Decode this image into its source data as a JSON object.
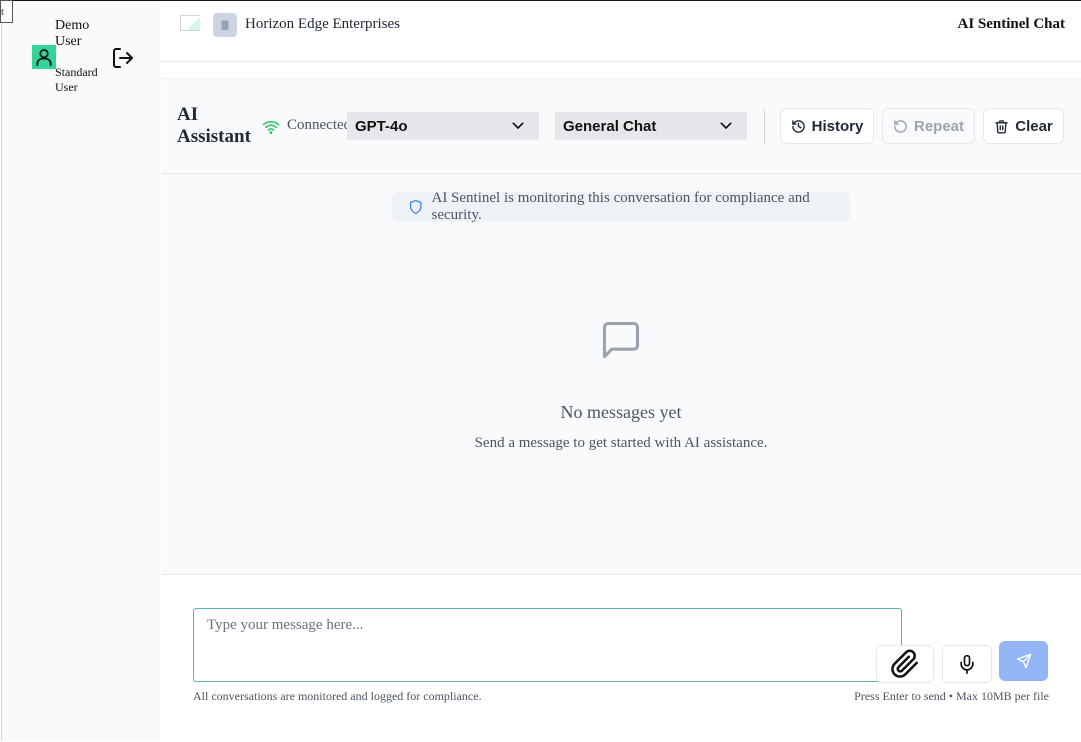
{
  "sidebar": {
    "user_name": "Demo User",
    "user_role": "Standard User",
    "icons": {
      "avatar": "user-icon",
      "logout": "logout-icon"
    },
    "avatar_color": "#34d399"
  },
  "header": {
    "company_name": "Horizon Edge Enterprises",
    "app_title": "AI Sentinel Chat",
    "icons": {
      "company": "building-icon"
    }
  },
  "toolbar": {
    "title": "AI Assistant",
    "status": "Connected",
    "status_color": "#22c55e",
    "model_select": {
      "selected": "GPT-4o"
    },
    "mode_select": {
      "selected": "General Chat"
    },
    "history_label": "History",
    "repeat_label": "Repeat",
    "clear_label": "Clear",
    "icons": {
      "status": "wifi-icon",
      "history": "history-icon",
      "repeat": "rotate-ccw-icon",
      "clear": "trash-icon"
    }
  },
  "chat": {
    "monitor_notice": "AI Sentinel is monitoring this conversation for compliance and security.",
    "empty_title": "No messages yet",
    "empty_subtitle": "Send a message to get started with AI assistance.",
    "icons": {
      "notice": "shield-icon",
      "empty": "message-square-icon"
    }
  },
  "composer": {
    "placeholder": "Type your message here...",
    "footer_left": "All conversations are monitored and logged for compliance.",
    "footer_right": "Press Enter to send • Max 10MB per file",
    "send_color": "#93b4f5",
    "icons": {
      "attach": "paperclip-icon",
      "mic": "mic-icon",
      "send": "send-icon"
    }
  }
}
